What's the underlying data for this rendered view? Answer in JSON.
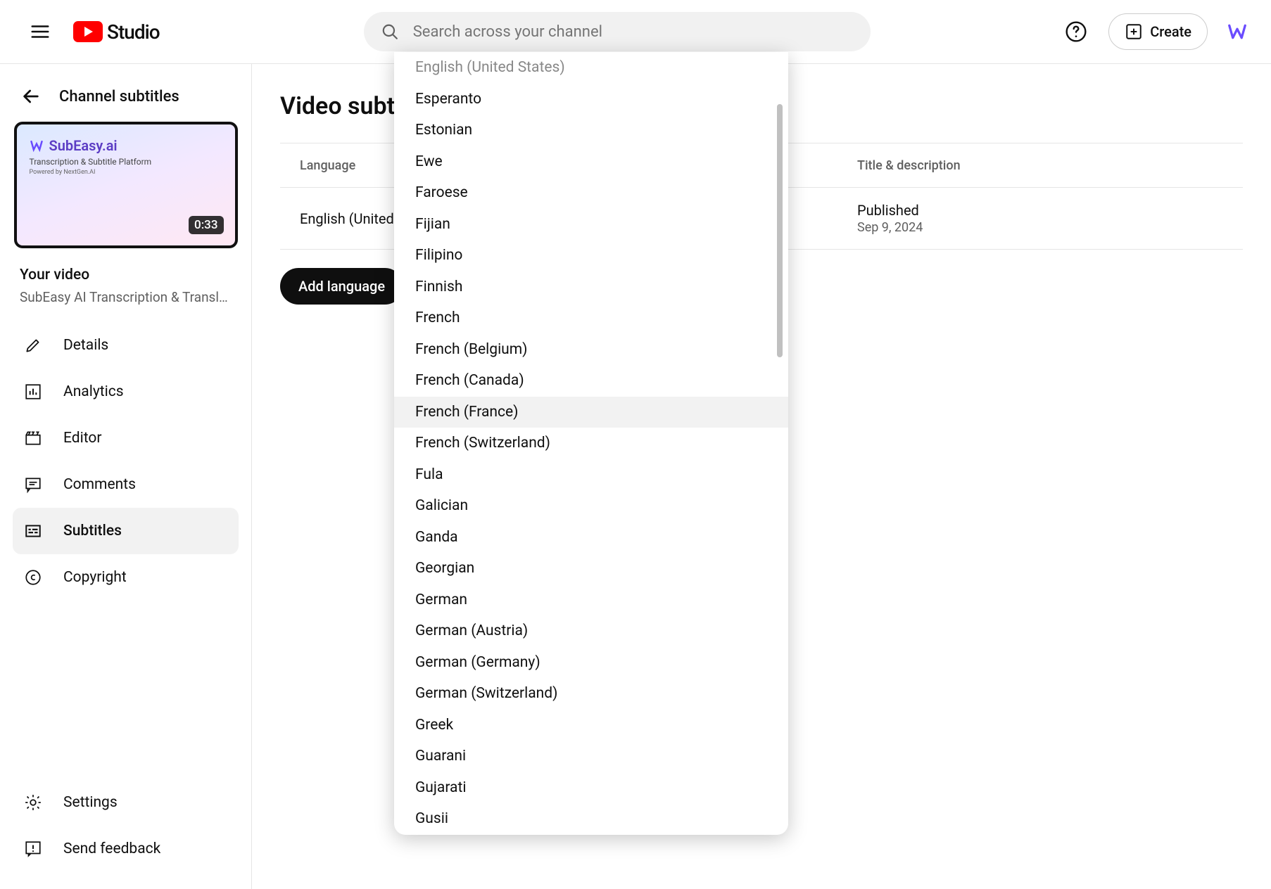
{
  "header": {
    "logo_text": "Studio",
    "search_placeholder": "Search across your channel",
    "create_label": "Create"
  },
  "sidebar": {
    "title": "Channel subtitles",
    "duration": "0:33",
    "your_video_label": "Your video",
    "video_name": "SubEasy AI Transcription & Translati...",
    "thumb_brand": "SubEasy.ai",
    "thumb_line1": "Transcription & Subtitle Platform",
    "thumb_line2": "Powered by NextGen.AI",
    "items": [
      {
        "label": "Details"
      },
      {
        "label": "Analytics"
      },
      {
        "label": "Editor"
      },
      {
        "label": "Comments"
      },
      {
        "label": "Subtitles"
      },
      {
        "label": "Copyright"
      }
    ],
    "settings_label": "Settings",
    "feedback_label": "Send feedback"
  },
  "content": {
    "page_title": "Video subtitles",
    "col_lang": "Language",
    "col_title": "Title & description",
    "row_lang": "English (United States)",
    "row_status": "Published",
    "row_date": "Sep 9, 2024",
    "add_lang": "Add language"
  },
  "dropdown": {
    "items": [
      "English (United States)",
      "Esperanto",
      "Estonian",
      "Ewe",
      "Faroese",
      "Fijian",
      "Filipino",
      "Finnish",
      "French",
      "French (Belgium)",
      "French (Canada)",
      "French (France)",
      "French (Switzerland)",
      "Fula",
      "Galician",
      "Ganda",
      "Georgian",
      "German",
      "German (Austria)",
      "German (Germany)",
      "German (Switzerland)",
      "Greek",
      "Guarani",
      "Gujarati",
      "Gusii"
    ],
    "hover_index": 11
  }
}
